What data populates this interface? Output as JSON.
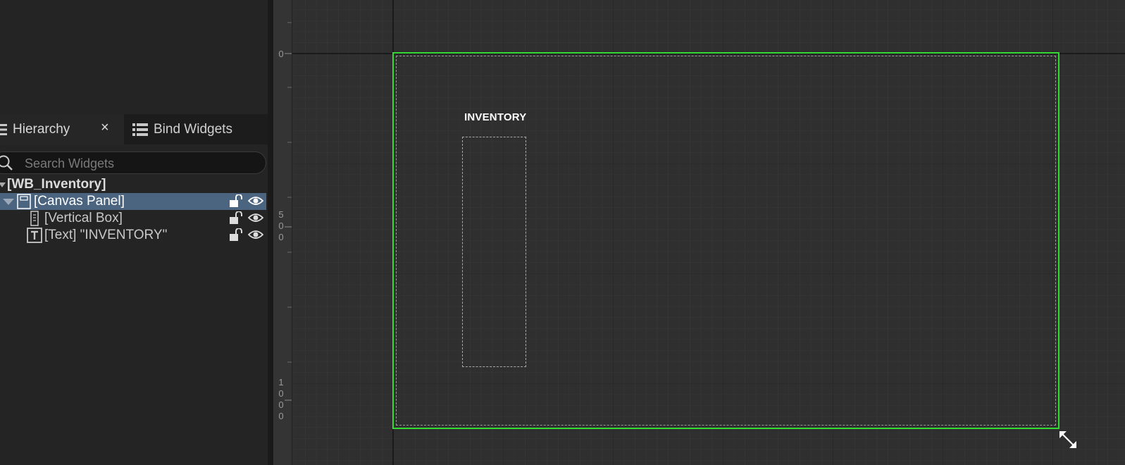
{
  "tabs": {
    "hierarchy_label": "Hierarchy",
    "close_label": "×",
    "bind_label": "Bind Widgets"
  },
  "search": {
    "placeholder": "Search Widgets"
  },
  "tree": {
    "root": "[WB_Inventory]",
    "canvas_panel": "[Canvas Panel]",
    "vertical_box": "[Vertical Box]",
    "text_widget": "[Text] \"INVENTORY\""
  },
  "ruler": {
    "mark_0": "0",
    "mark_500": [
      "5",
      "0",
      "0"
    ],
    "mark_1000": [
      "1",
      "0",
      "0",
      "0"
    ]
  },
  "canvas": {
    "inventory_text": "INVENTORY"
  },
  "colors": {
    "selection_row": "#4b6480",
    "frame_outline": "#34d934",
    "background": "#242424"
  }
}
